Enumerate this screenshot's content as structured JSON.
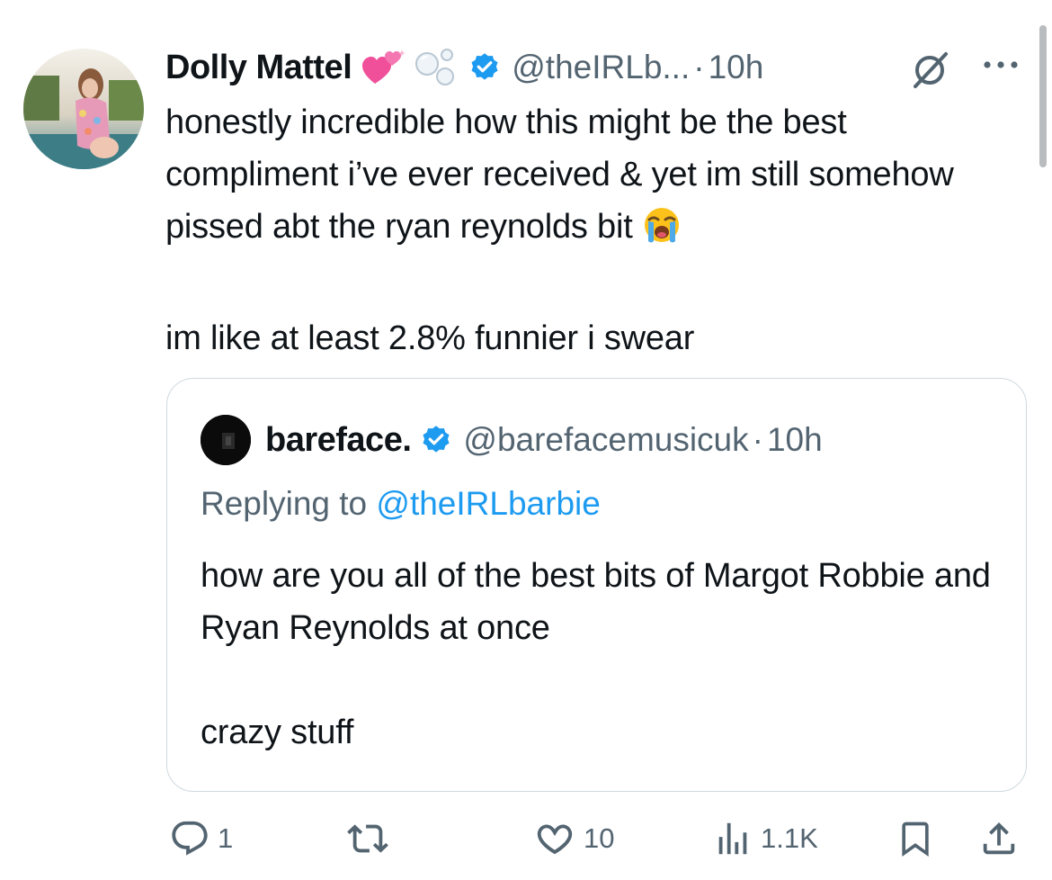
{
  "tweet": {
    "author": {
      "display_name": "Dolly Mattel",
      "handle": "@theIRLb...",
      "verified": true,
      "name_emojis": [
        "sparkling-heart-emoji",
        "bubbles-emoji"
      ]
    },
    "separator": "·",
    "time": "10h",
    "text": "honestly incredible how this might be the best compliment i’ve ever received & yet im still somehow pissed abt the ryan reynolds bit",
    "text_emoji": "loudly-crying-face-emoji",
    "text_line2": "im like at least 2.8% funnier i swear",
    "quoted": {
      "display_name": "bareface.",
      "handle": "@barefacemusicuk",
      "verified": true,
      "separator": "·",
      "time": "10h",
      "replying_label": "Replying to",
      "replying_mention": "@theIRLbarbie",
      "text": "how are you all of the best bits of Margot Robbie and Ryan Reynolds at once\n\ncrazy stuff"
    },
    "actions": {
      "replies": "1",
      "retweets": "",
      "likes": "10",
      "views": "1.1K"
    }
  },
  "colors": {
    "text": "#0f1419",
    "secondary": "#536471",
    "accent": "#1d9bf0",
    "border": "#cfd9de"
  }
}
